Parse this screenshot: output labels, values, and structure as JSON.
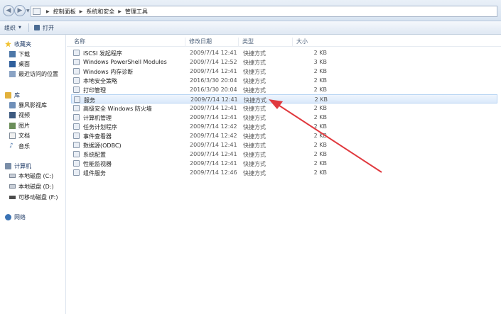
{
  "address": {
    "crumbs": [
      "控制面板",
      "系统和安全",
      "管理工具"
    ]
  },
  "toolbar": {
    "organize_label": "组织",
    "open_label": "打开"
  },
  "nav": {
    "favorites": {
      "header": "收藏夹",
      "items": [
        "下载",
        "桌面",
        "最近访问的位置"
      ]
    },
    "library": {
      "header": "库",
      "items": [
        "暴风影视库",
        "视频",
        "图片",
        "文档",
        "音乐"
      ]
    },
    "computer": {
      "header": "计算机",
      "items": [
        "本地磁盘 (C:)",
        "本地磁盘 (D:)",
        "可移动磁盘 (F:)"
      ]
    },
    "network": {
      "header": "网络"
    }
  },
  "columns": {
    "name": "名称",
    "date": "修改日期",
    "type": "类型",
    "size": "大小"
  },
  "files": [
    {
      "name": "iSCSI 发起程序",
      "date": "2009/7/14 12:41",
      "type": "快捷方式",
      "size": "2 KB"
    },
    {
      "name": "Windows PowerShell Modules",
      "date": "2009/7/14 12:52",
      "type": "快捷方式",
      "size": "3 KB"
    },
    {
      "name": "Windows 内存诊断",
      "date": "2009/7/14 12:41",
      "type": "快捷方式",
      "size": "2 KB"
    },
    {
      "name": "本地安全策略",
      "date": "2016/3/30 20:04",
      "type": "快捷方式",
      "size": "2 KB"
    },
    {
      "name": "打印管理",
      "date": "2016/3/30 20:04",
      "type": "快捷方式",
      "size": "2 KB"
    },
    {
      "name": "服务",
      "date": "2009/7/14 12:41",
      "type": "快捷方式",
      "size": "2 KB"
    },
    {
      "name": "高级安全 Windows 防火墙",
      "date": "2009/7/14 12:41",
      "type": "快捷方式",
      "size": "2 KB"
    },
    {
      "name": "计算机管理",
      "date": "2009/7/14 12:41",
      "type": "快捷方式",
      "size": "2 KB"
    },
    {
      "name": "任务计划程序",
      "date": "2009/7/14 12:42",
      "type": "快捷方式",
      "size": "2 KB"
    },
    {
      "name": "事件查看器",
      "date": "2009/7/14 12:42",
      "type": "快捷方式",
      "size": "2 KB"
    },
    {
      "name": "数据源(ODBC)",
      "date": "2009/7/14 12:41",
      "type": "快捷方式",
      "size": "2 KB"
    },
    {
      "name": "系统配置",
      "date": "2009/7/14 12:41",
      "type": "快捷方式",
      "size": "2 KB"
    },
    {
      "name": "性能监视器",
      "date": "2009/7/14 12:41",
      "type": "快捷方式",
      "size": "2 KB"
    },
    {
      "name": "组件服务",
      "date": "2009/7/14 12:46",
      "type": "快捷方式",
      "size": "2 KB"
    }
  ],
  "selected_index": 5,
  "colors": {
    "annotation_arrow": "#e0393e",
    "selection_border": "#b7d4f3"
  }
}
